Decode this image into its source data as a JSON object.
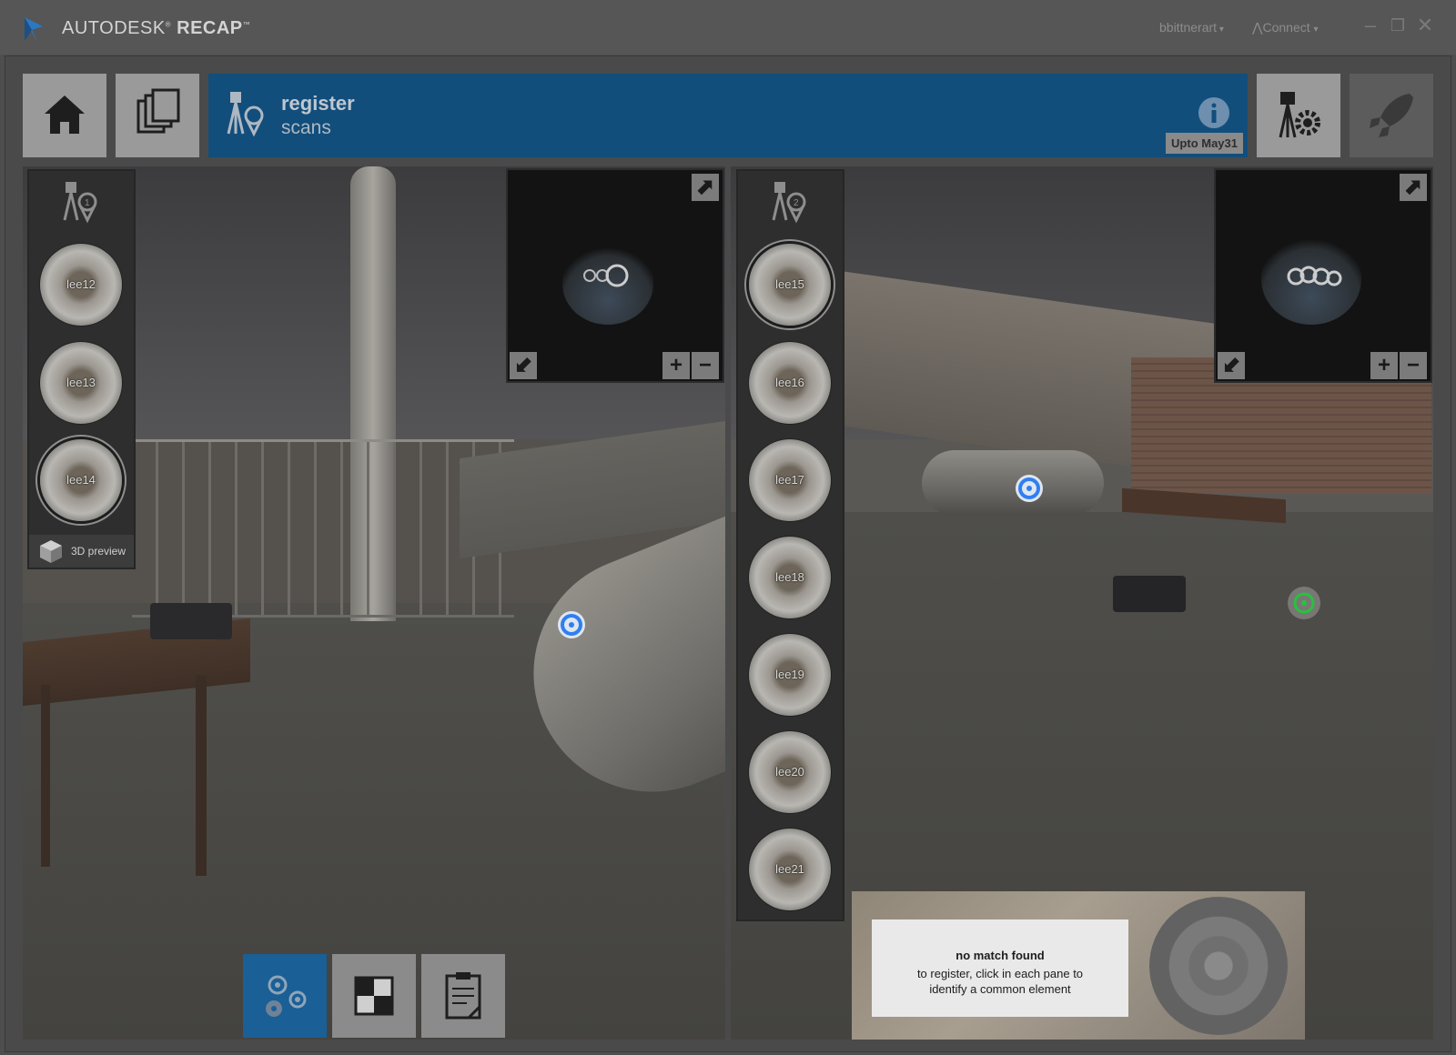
{
  "titlebar": {
    "app_name_light": "AUTODESK",
    "app_name_bold": "RECAP",
    "user_menu": "bbittnerart",
    "connect_menu": "Connect"
  },
  "header": {
    "title": "register",
    "subtitle": "scans",
    "version_badge": "Upto May31"
  },
  "left_pane": {
    "scan_group_badge": "1",
    "scans": [
      "lee12",
      "lee13",
      "lee14"
    ],
    "selected_scan": "lee14",
    "preview_label": "3D preview"
  },
  "right_pane": {
    "scan_group_badge": "2",
    "scans": [
      "lee15",
      "lee16",
      "lee17",
      "lee18",
      "lee19",
      "lee20",
      "lee21"
    ],
    "selected_scan": "lee15"
  },
  "notice": {
    "title": "no match found",
    "message": "to register, click in each pane to identify a common element"
  },
  "colors": {
    "header_bg": "#124e7c",
    "accent_blue": "#1a5f96",
    "marker_blue": "#2f7ff0",
    "marker_green": "#27c23c"
  },
  "icons": [
    "home-icon",
    "projects-icon",
    "register-scans-icon",
    "info-icon",
    "scan-settings-icon",
    "launch-icon",
    "expand-icon",
    "collapse-icon",
    "zoom-in-icon",
    "zoom-out-icon",
    "cube-icon",
    "auto-register-icon",
    "checker-icon",
    "report-icon"
  ]
}
